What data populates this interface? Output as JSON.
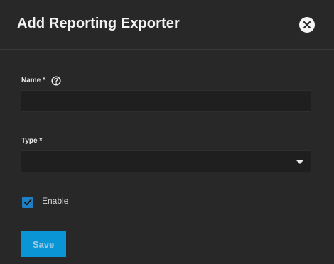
{
  "dialog": {
    "title": "Add Reporting Exporter",
    "close_icon": "close-icon"
  },
  "form": {
    "name": {
      "label": "Name",
      "required_mark": "*",
      "value": "",
      "help_icon": "help-icon"
    },
    "type": {
      "label": "Type",
      "required_mark": "*",
      "selected": "",
      "dropdown_icon": "chevron-down-icon"
    },
    "enable": {
      "label": "Enable",
      "checked": true
    }
  },
  "actions": {
    "save_label": "Save"
  },
  "colors": {
    "background": "#282828",
    "field": "#1f1f1f",
    "checkbox": "#1f7fc4",
    "save_button": "#0a95d6",
    "save_text_disabled": "#9fc9e3"
  }
}
